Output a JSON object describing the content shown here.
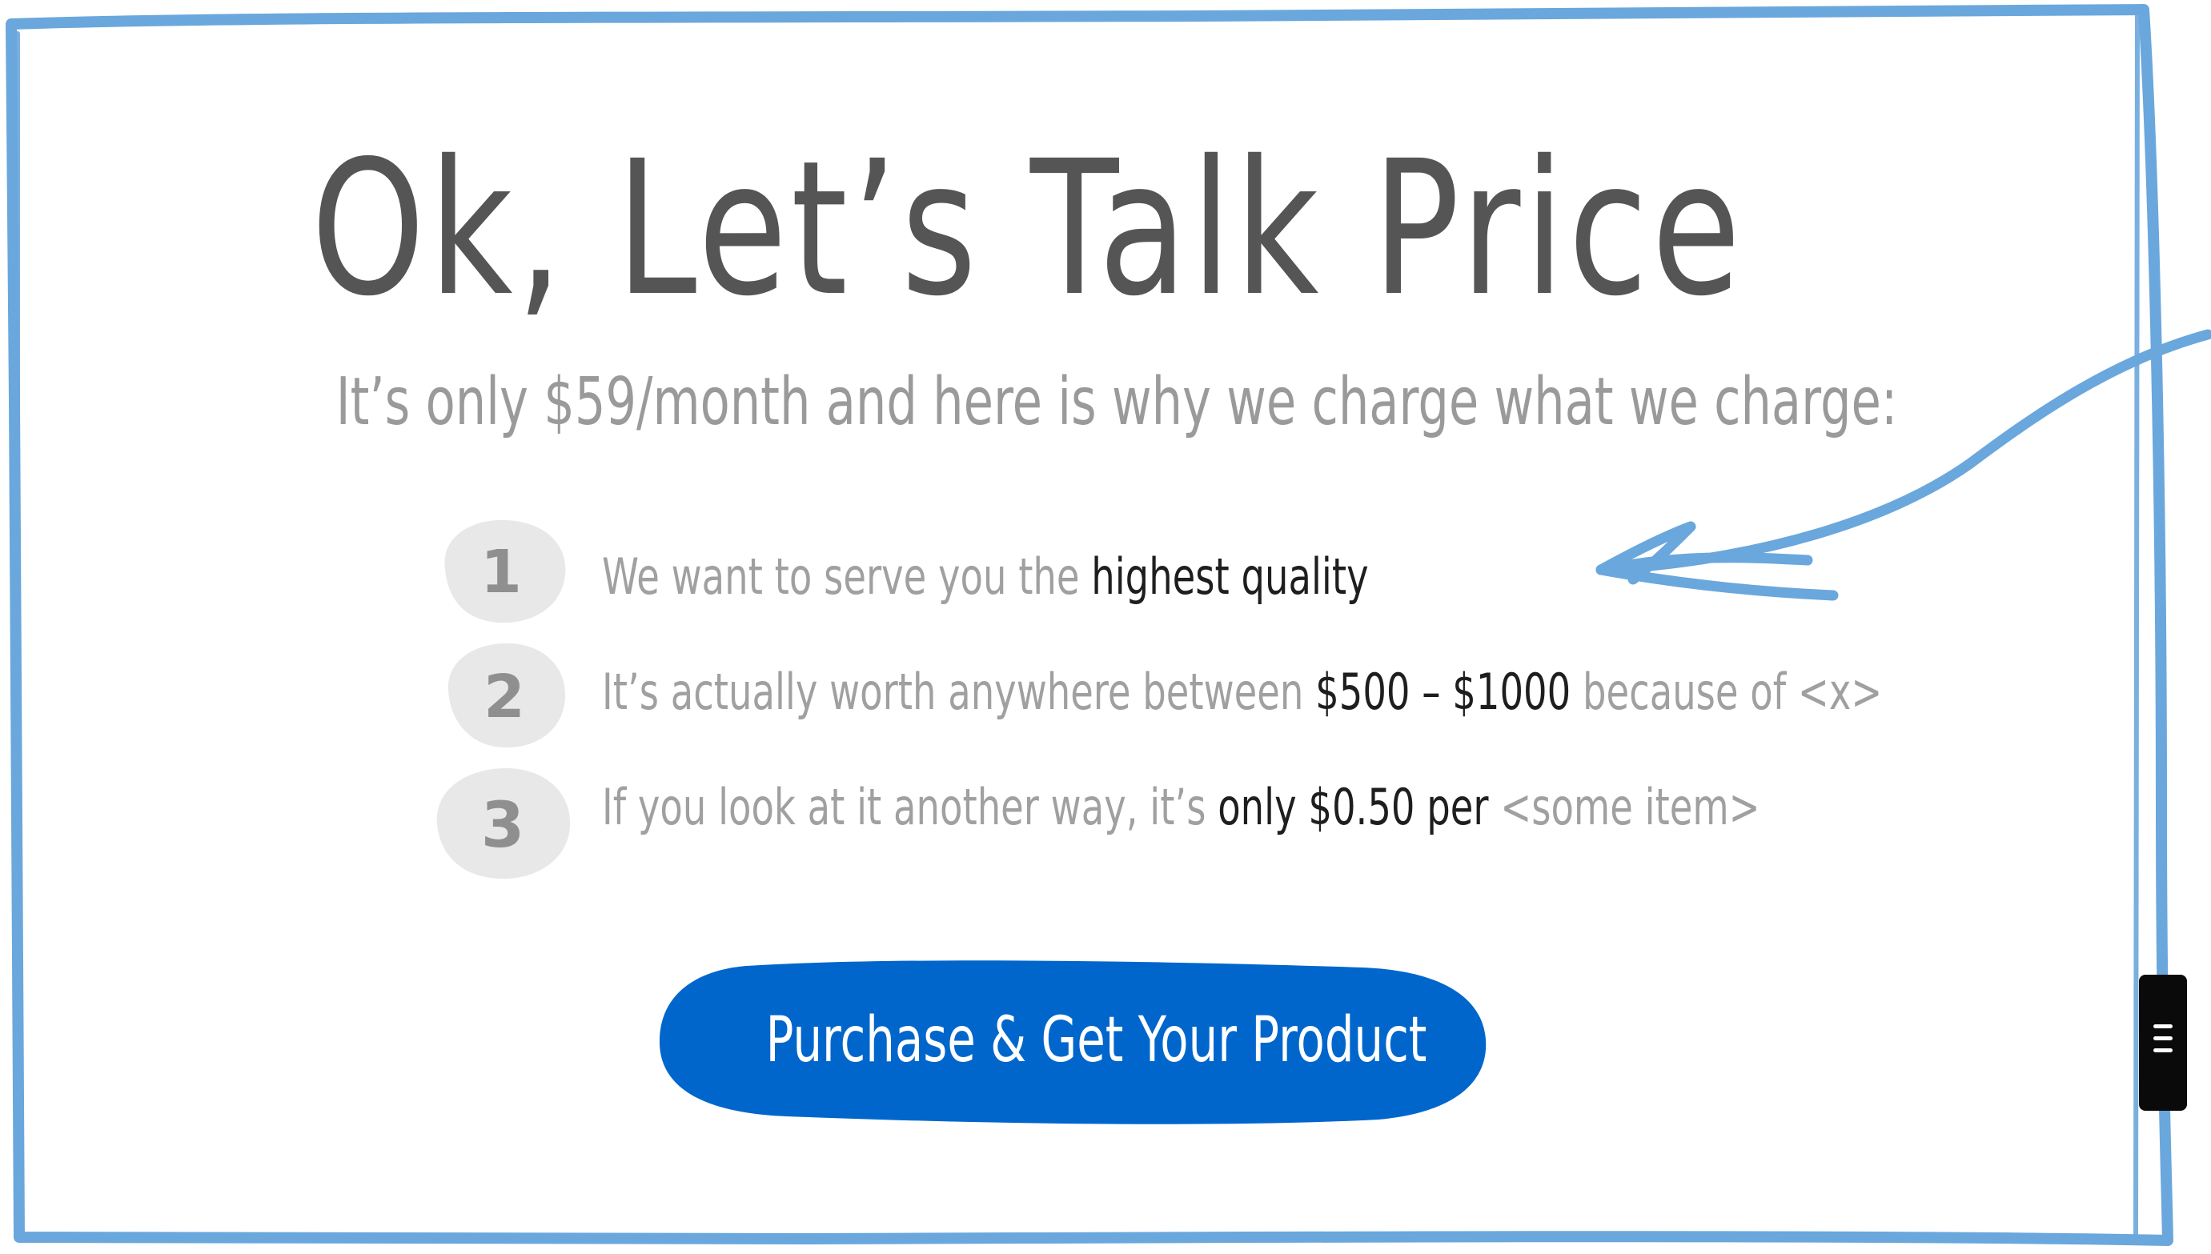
{
  "headline": "Ok, Let’s Talk Price",
  "subheadline": "It’s only $59/month and here is why we charge what we charge:",
  "reasons": [
    {
      "number": "1",
      "parts": [
        "We want to serve you the ",
        "highest quality",
        ""
      ]
    },
    {
      "number": "2",
      "parts": [
        "It’s actually worth anywhere between ",
        "$500 – $1000",
        " because of <x>"
      ]
    },
    {
      "number": "3",
      "parts": [
        "If you look at it another way, it’s ",
        "only $0.50 per",
        " <some item>"
      ]
    }
  ],
  "cta": {
    "label": "Purchase & Get Your Product"
  },
  "colors": {
    "frame": "#6aa7dc",
    "cta": "#0066cc",
    "headline": "#555555",
    "muted_text": "#9a9a9a",
    "strong_text": "#1e1e1e",
    "badge_fill": "#e8e8e8",
    "badge_digit": "#8f8f8f"
  },
  "icons": {
    "frame": "hand-drawn-frame",
    "pointer": "hand-drawn-arrow-icon",
    "menu": "hamburger-menu-icon"
  }
}
